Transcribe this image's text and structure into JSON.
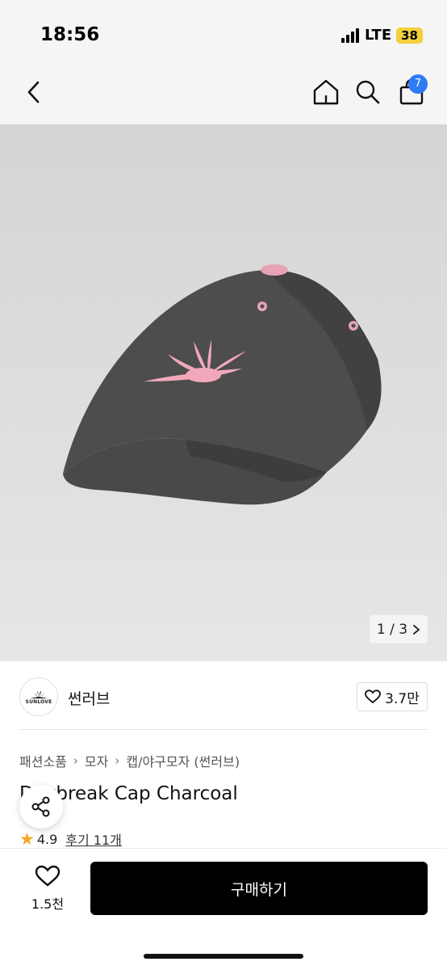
{
  "status_bar": {
    "time": "18:56",
    "network": "LTE",
    "battery": "38"
  },
  "nav": {
    "cart_count": "7",
    "icons": [
      "chevron-left-icon",
      "home-icon",
      "search-icon",
      "shopping-bag-icon"
    ]
  },
  "gallery": {
    "counter": "1 / 3"
  },
  "brand": {
    "logo_text": "SUNLOVE",
    "name": "썬러브",
    "likes": "3.7만"
  },
  "breadcrumb": [
    "패션소품",
    "모자",
    "캡/야구모자 (썬러브)"
  ],
  "product": {
    "title": "Daybreak Cap Charcoal",
    "rating": "4.9",
    "reviews": "후기 11개"
  },
  "bottom": {
    "wish_count": "1.5천",
    "buy_label": "구매하기"
  },
  "colors": {
    "accent": "#2d7cf6",
    "cap": "#4a4a4a",
    "logo_pink": "#f2a8bb",
    "star": "#f5a623"
  }
}
